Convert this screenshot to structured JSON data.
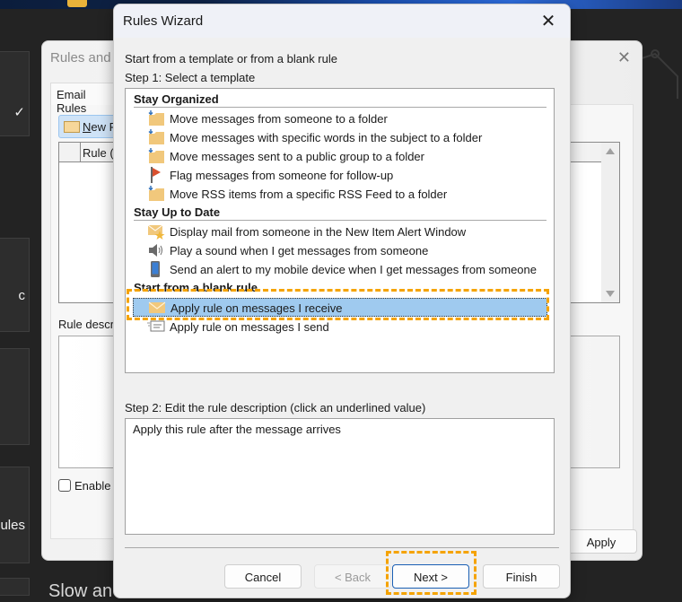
{
  "background": {
    "left_tiles": [
      {
        "text": "✓"
      },
      {
        "text": "c"
      },
      {
        "text": ""
      },
      {
        "text": "ules"
      }
    ],
    "bottom_text": "Slow an"
  },
  "rules_and_alerts": {
    "title": "Rules and A",
    "tab": "Email Rules",
    "new_rule_accel": "N",
    "new_rule_rest": "ew R",
    "list_column": "Rule (",
    "desc_label": "Rule descr",
    "enable_label": "Enable",
    "apply_label": "Apply"
  },
  "wizard": {
    "title": "Rules Wizard",
    "intro": "Start from a template or from a blank rule",
    "step1_label": "Step 1: Select a template",
    "groups": [
      {
        "header": "Stay Organized",
        "items": [
          {
            "icon": "move-to-folder-icon",
            "label": "Move messages from someone to a folder"
          },
          {
            "icon": "move-to-folder-icon",
            "label": "Move messages with specific words in the subject to a folder"
          },
          {
            "icon": "move-to-folder-icon",
            "label": "Move messages sent to a public group to a folder"
          },
          {
            "icon": "flag-icon",
            "label": "Flag messages from someone for follow-up"
          },
          {
            "icon": "move-to-folder-icon",
            "label": "Move RSS items from a specific RSS Feed to a folder"
          }
        ]
      },
      {
        "header": "Stay Up to Date",
        "items": [
          {
            "icon": "mail-alert-star-icon",
            "label": "Display mail from someone in the New Item Alert Window"
          },
          {
            "icon": "speaker-icon",
            "label": "Play a sound when I get messages from someone"
          },
          {
            "icon": "mobile-device-icon",
            "label": "Send an alert to my mobile device when I get messages from someone"
          }
        ]
      },
      {
        "header": "Start from a blank rule",
        "items": [
          {
            "icon": "envelope-receive-icon",
            "label": "Apply rule on messages I receive",
            "selected": true
          },
          {
            "icon": "envelope-send-icon",
            "label": "Apply rule on messages I send"
          }
        ]
      }
    ],
    "step2_label": "Step 2: Edit the rule description (click an underlined value)",
    "description": "Apply this rule after the message arrives",
    "buttons": {
      "cancel": "Cancel",
      "back": "< Back",
      "next": "Next >",
      "finish": "Finish"
    }
  },
  "highlight_color": "#f5a300"
}
